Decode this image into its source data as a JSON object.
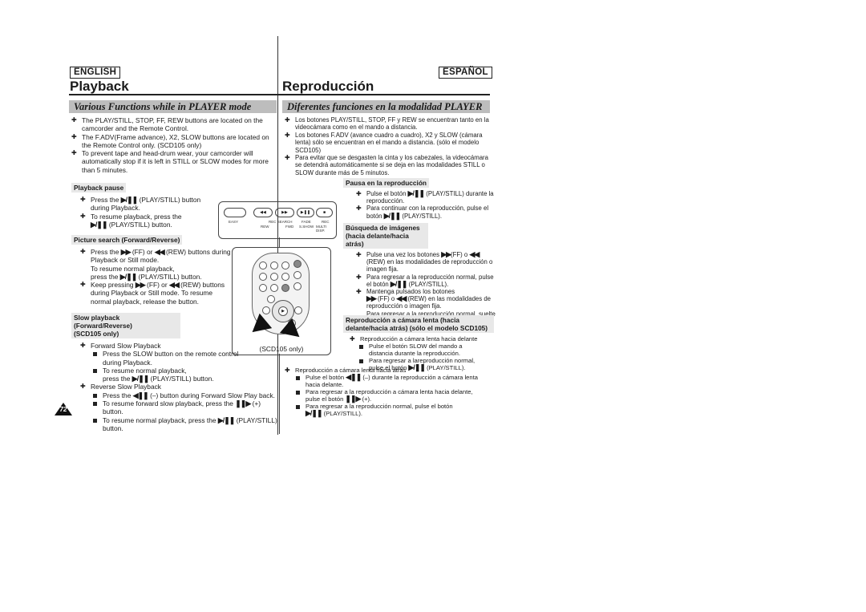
{
  "left": {
    "lang_label": "ENGLISH",
    "title": "Playback",
    "banner": "Various Functions while in PLAYER mode",
    "intro": [
      "The PLAY/STILL, STOP, FF, REW buttons are located on the camcorder and the Remote Control.",
      "The F.ADV(Frame advance), X2, SLOW buttons are located on the Remote Control only. (SCD105 only)",
      "To prevent tape and head-drum wear, your camcorder will automatically stop if it is left in STILL or SLOW modes for more than 5 minutes."
    ],
    "pause": {
      "heading": "Playback pause",
      "b1_pre": "Press the",
      "b1_post": "(PLAY/STILL) button during Playback.",
      "b2_pre": "To resume playback, press the",
      "b2_post": "(PLAY/STILL) button."
    },
    "search": {
      "heading": "Picture search (Forward/Reverse)",
      "b1_a": "Press the",
      "b1_b": "(FF) or",
      "b1_c": "(REW) buttons during Playback or Still mode.",
      "b1_d": "To resume normal playback,",
      "b1_e": "press the",
      "b1_f": "(PLAY/STILL) button.",
      "b2_a": "Keep pressing",
      "b2_b": "(FF) or",
      "b2_c": "(REW) buttons during Playback or Still mode. To resume normal playback, release the button."
    },
    "slow": {
      "heading_1": "Slow playback (Forward/Reverse)",
      "heading_2": "(SCD105 only)",
      "fwd_title": "Forward Slow Playback",
      "fwd_1": "Press the SLOW button on the remote control during Playback.",
      "fwd_2a": "To resume normal playback,",
      "fwd_2b": "press the",
      "fwd_2c": "(PLAY/STILL) button.",
      "rev_title": "Reverse Slow Playback",
      "rev_1a": "Press the",
      "rev_1b": "(–) button during Forward Slow Play back.",
      "rev_2a": "To resume forward slow playback, press the",
      "rev_2b": "(+) button.",
      "rev_3a": "To resume normal playback, press the",
      "rev_3b": "(PLAY/STILL) button."
    },
    "page_number": "72"
  },
  "right": {
    "lang_label": "ESPAÑOL",
    "title": "Reproducción",
    "banner": "Diferentes funciones en la modalidad PLAYER",
    "intro": [
      "Los botones PLAY/STILL, STOP, FF y REW se encuentran tanto en la videocámara como en el mando a distancia.",
      "Los botones F.ADV (avance cuadro a cuadro), X2 y SLOW (cámara lenta) sólo se encuentran en el mando a distancia. (sólo el modelo SCD105)",
      "Para evitar que se desgasten la cinta y los cabezales, la videocámara se detendrá automáticamente si se deja en las modalidades STILL o SLOW durante más de 5 minutos."
    ],
    "pause": {
      "heading": "Pausa en la reproducción",
      "b1_pre": "Pulse el botón",
      "b1_post": "(PLAY/STILL) durante la reproducción.",
      "b2_pre": "Para continuar con la reproducción, pulse el botón",
      "b2_post": "(PLAY/STILL)."
    },
    "search": {
      "heading_1": "Búsqueda de imágenes",
      "heading_2": "(hacia delante/hacia atrás)",
      "b1_a": "Pulse una vez los botones",
      "b1_b": "(FF) o",
      "b1_c": "(REW) en las modalidades de reproducción o imagen fija.",
      "b2_a": "Para regresar a la reproducción normal, pulse el botón",
      "b2_b": "(PLAY/STILL).",
      "b3_a": "Mantenga pulsados los botones",
      "b3_b": "(FF) o",
      "b3_c": "(REW) en las modalidades de reproducción o imagen fija.",
      "b3_d": "Para regresar a la reproducción normal, suelte el botón."
    },
    "slow": {
      "heading": "Reproducción a cámara lenta (hacia delante/hacia atrás) (sólo el modelo SCD105)",
      "fwd_title": "Reproducción a cámara lenta hacia delante",
      "fwd_1": "Pulse el botón SLOW del mando a distancia durante la reproducción.",
      "fwd_2a": "Para regresar a lareproducción normal, pulse el botón",
      "fwd_2b": "(PLAY/STILL).",
      "rev_title": "Reproducción a cámara lenta hacia atrás",
      "rev_1a": "Pulse el botón",
      "rev_1b": "(–) durante la reproducción a cámara lenta hacia delante.",
      "rev_2a": "Para regresar a la reproducción a cámara lenta hacia delante, pulse el botón",
      "rev_2b": "(+).",
      "rev_3a": "Para regresar a la reproducción normal, pulse el botón",
      "rev_3b": "(PLAY/STILL)."
    }
  },
  "icons": {
    "play_still": "▶/❚❚",
    "ff": "▶▶",
    "rew": "◀◀",
    "slow_rev": "◀❚❚",
    "slow_fwd": "❚❚▶"
  },
  "camcorder_panel": {
    "easy": "EASY",
    "rec_search": "REC SEARCH",
    "rew": "REW",
    "fwd": "FWD",
    "fade": "FADE",
    "sshow": "S.SHOW",
    "rec": "REC",
    "multi_disp": "MULTI DISP."
  },
  "remote_caption": "(SCD105 only)"
}
